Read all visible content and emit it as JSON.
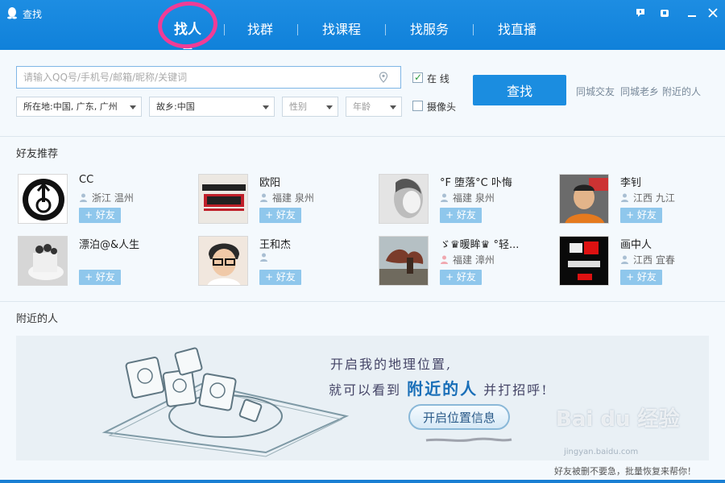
{
  "window": {
    "title": "查找"
  },
  "nav": {
    "tabs": [
      {
        "label": "找人",
        "active": true
      },
      {
        "label": "找群"
      },
      {
        "label": "找课程"
      },
      {
        "label": "找服务"
      },
      {
        "label": "找直播"
      }
    ]
  },
  "search": {
    "placeholder": "请输入QQ号/手机号/邮箱/昵称/关键词",
    "location": "所在地:中国, 广东, 广州",
    "hometown": "故乡:中国",
    "gender": "性别",
    "age": "年龄",
    "online_label": "在  线",
    "online_checked": true,
    "camera_label": "摄像头",
    "camera_checked": false,
    "find_label": "查找",
    "links": [
      "同城交友",
      "同城老乡",
      "附近的人"
    ]
  },
  "friends": {
    "title": "好友推荐",
    "add_label": "+ 好友",
    "items": [
      {
        "name": "CC",
        "location": "浙江 温州"
      },
      {
        "name": "欧阳",
        "location": "福建 泉州"
      },
      {
        "name": "°F 堕落°C 卟悔",
        "location": "福建 泉州"
      },
      {
        "name": "李钊",
        "location": "江西 九江"
      },
      {
        "name": "漂泊@&人生",
        "location": ""
      },
      {
        "name": "王和杰",
        "location": ""
      },
      {
        "name": "ゞ♛暖眸♛ °轻...",
        "location": "福建 漳州"
      },
      {
        "name": "画中人",
        "location": "江西 宜春"
      }
    ]
  },
  "nearby": {
    "title": "附近的人",
    "line1": "开启我的地理位置,",
    "line2_pre": "就可以看到",
    "line2_hl": "附近的人",
    "line2_post": "并打招呼!",
    "button": "开启位置信息"
  },
  "watermark": {
    "brand": "Bai du 经验",
    "url": "jingyan.baidu.com"
  },
  "status": {
    "text": "好友被删不要急，批量恢复来帮你！"
  },
  "colors": {
    "titlebar": "#1d8de2",
    "button": "#1b8de0",
    "add_button": "#8fc7ec",
    "highlight": "#f03c96"
  }
}
